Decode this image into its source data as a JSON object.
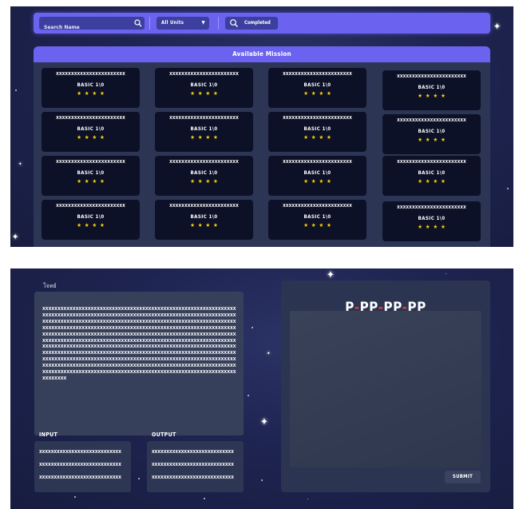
{
  "filters": {
    "search_placeholder": "Search Name",
    "unit_select": "All Units",
    "status_label": "Completed"
  },
  "missions": {
    "header": "Available Mission",
    "cards": [
      {
        "title": "XXXXXXXXXXXXXXXXXXXXXXX",
        "level": "BASIC 1\\0",
        "stars": "★★★★"
      },
      {
        "title": "XXXXXXXXXXXXXXXXXXXXXXX",
        "level": "BASIC 1\\0",
        "stars": "★★★★"
      },
      {
        "title": "XXXXXXXXXXXXXXXXXXXXXXX",
        "level": "BASIC 1\\0",
        "stars": "★★★★"
      },
      {
        "title": "XXXXXXXXXXXXXXXXXXXXXXX",
        "level": "BASIC 1\\0",
        "stars": "★★★★"
      },
      {
        "title": "XXXXXXXXXXXXXXXXXXXXXXX",
        "level": "BASIC 1\\0",
        "stars": "★★★★"
      },
      {
        "title": "XXXXXXXXXXXXXXXXXXXXXXX",
        "level": "BASIC 1\\0",
        "stars": "★★★★"
      },
      {
        "title": "XXXXXXXXXXXXXXXXXXXXXXX",
        "level": "BASIC 1\\0",
        "stars": "★★★★"
      },
      {
        "title": "XXXXXXXXXXXXXXXXXXXXXXX",
        "level": "BASIC 1\\0",
        "stars": "★★★★"
      },
      {
        "title": "XXXXXXXXXXXXXXXXXXXXXXX",
        "level": "BASIC 1\\0",
        "stars": "★★★★"
      },
      {
        "title": "XXXXXXXXXXXXXXXXXXXXXXX",
        "level": "BASIC 1\\0",
        "stars": "★★★★"
      },
      {
        "title": "XXXXXXXXXXXXXXXXXXXXXXX",
        "level": "BASIC 1\\0",
        "stars": "★★★★"
      },
      {
        "title": "XXXXXXXXXXXXXXXXXXXXXXX",
        "level": "BASIC 1\\0",
        "stars": "★★★★"
      },
      {
        "title": "XXXXXXXXXXXXXXXXXXXXXXX",
        "level": "BASIC 1\\0",
        "stars": "★★★★"
      },
      {
        "title": "XXXXXXXXXXXXXXXXXXXXXXX",
        "level": "BASIC 1\\0",
        "stars": "★★★★"
      },
      {
        "title": "XXXXXXXXXXXXXXXXXXXXXXX",
        "level": "BASIC 1\\0",
        "stars": "★★★★"
      },
      {
        "title": "XXXXXXXXXXXXXXXXXXXXXXX",
        "level": "BASIC 1\\0",
        "stars": "★★★★"
      }
    ]
  },
  "editor": {
    "code_label": "โจทย์",
    "code_text": "XXXXXXXXXXXXXXXXXXXXXXXXXXXXXXXXXXXXXXXXXXXXXXXXXXXXXXXXXXXXXXXXXXXXXXXXXXXXXXXXXXXXXXXXXXXXXXXXXXXXXXXXXXXXXXXXXXXXXXXXXXXXXXXXXXXXXXXXXXXXXXXXXXXXXXXXXXXXXXXXXXXXXXXXXXXXXXXXXXXXXXXXXXXXXXXXXXXXXXXXXXXXXXXXXXXXXXXXXXXXXXXXXXXXXXXXXXXXXXXXXXXXXXXXXXXXXXXXXXXXXXXXXXXXXXXXXXXXXXXXXXXXXXXXXXXXXXXXXXXXXXXXXXXXXXXXXXXXXXXXXXXXXXXXXXXXXXXXXXXXXXXXXXXXXXXXXXXXXXXXXXXXXXXXXXXXXXXXXXXXXXXXXXXXXXXXXXXXXXXXXXXXXXXXXXXXXXXXXXXXXXXXXXXXXXXXXXXXXXXXXXXXXXXXXXXXXXXXXXXXXXXXXXXXXXXXXXXXXXXXXXXXXXXXXXXXXXXXXXXXXXXXXXXXXXXXXXXXXXXXXXXXXXXXXXXXXXXXXXXXXXXXXXXXXXXXXXXXXXXXXXXXXXXXXXXXXXXXXXXXXXXXXXXXXXXXXXXXXXXXXXXXXXXXXXXXXXXXXXXXXXXXXXXXXXXXXXXXXXXXXXXXXXXXXXXXXXXXXXXXXXXXXXXXXXXXXXXXXXXXXXXXXXXXXXXXXXXXXXXXXXXXXXXXXXXX",
    "input_label": "INPUT",
    "output_label": "OUTPUT",
    "input_lines": [
      "XXXXXXXXXXXXXXXXXXXXXXXXXXXX",
      "XXXXXXXXXXXXXXXXXXXXXXXXXXXX",
      "XXXXXXXXXXXXXXXXXXXXXXXXXXXX"
    ],
    "output_lines": [
      "XXXXXXXXXXXXXXXXXXXXXXXXXXXX",
      "XXXXXXXXXXXXXXXXXXXXXXXXXXXX",
      "XXXXXXXXXXXXXXXXXXXXXXXXXXXX"
    ]
  },
  "answer": {
    "title_parts": [
      "P",
      "PP",
      "PP",
      "PP"
    ],
    "submit_label": "SUBMIT"
  },
  "colors": {
    "accent": "#6b63f0",
    "star": "#ffd200",
    "title_dash": "#e23b3b"
  }
}
